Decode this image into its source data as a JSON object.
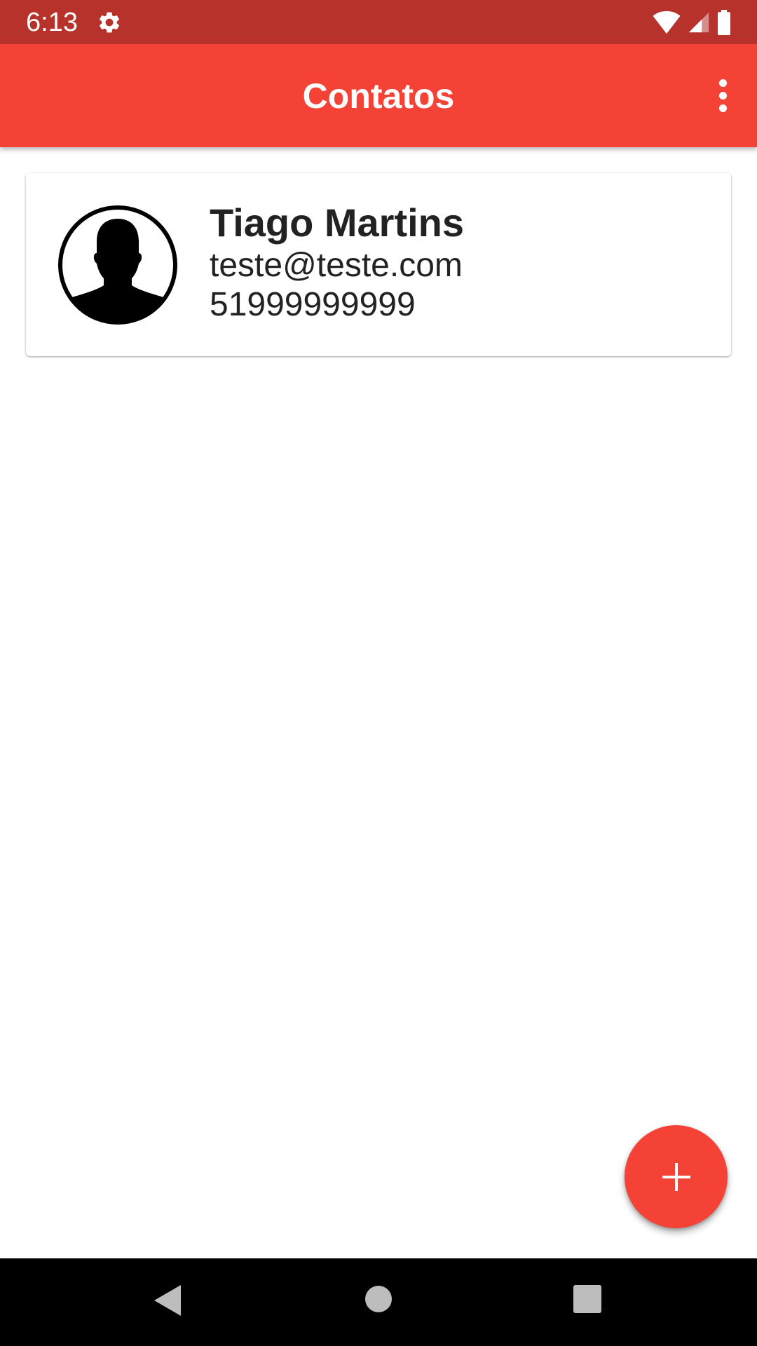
{
  "status_bar": {
    "time": "6:13",
    "icons": [
      "gear-icon",
      "wifi-icon",
      "signal-icon",
      "battery-icon"
    ],
    "color": "#b7322b"
  },
  "app_bar": {
    "title": "Contatos",
    "color": "#f44336",
    "menu_icon": "more-vert-icon"
  },
  "contacts": [
    {
      "name": "Tiago Martins",
      "email": "teste@teste.com",
      "phone": "51999999999",
      "avatar_icon": "person-avatar-icon"
    }
  ],
  "fab": {
    "icon": "plus-icon",
    "color": "#f44336"
  },
  "nav_bar": {
    "icons": [
      "back-icon",
      "home-icon",
      "recents-icon"
    ]
  }
}
